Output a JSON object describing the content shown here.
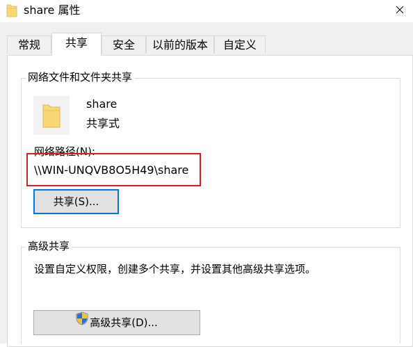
{
  "window": {
    "title": "share 属性",
    "folder_icon_color": "#f8d775"
  },
  "tabs": [
    {
      "label": "常规",
      "active": false
    },
    {
      "label": "共享",
      "active": true
    },
    {
      "label": "安全",
      "active": false
    },
    {
      "label": "以前的版本",
      "active": false
    },
    {
      "label": "自定义",
      "active": false
    }
  ],
  "network_sharing": {
    "group_title": "网络文件和文件夹共享",
    "folder_name": "share",
    "status": "共享式",
    "path_label": "网络路径(N):",
    "path_value": "\\\\WIN-UNQVB8O5H49\\share",
    "share_button": "共享(S)..."
  },
  "advanced_sharing": {
    "group_title": "高级共享",
    "description": "设置自定义权限，创建多个共享，并设置其他高级共享选项。",
    "button": "高级共享(D)..."
  },
  "colors": {
    "highlight": "#e01b1b",
    "focus_border": "#0078d7"
  }
}
